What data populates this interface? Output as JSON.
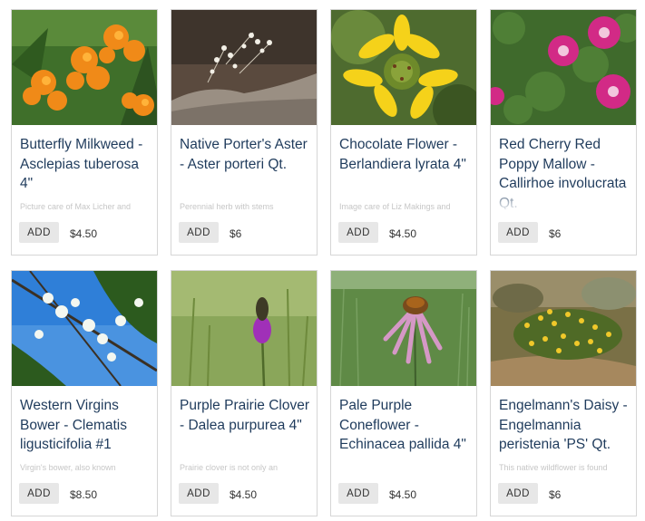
{
  "add_label": "ADD",
  "products": [
    {
      "title": "Butterfly Milkweed - Asclepias tuberosa 4\"",
      "desc": "Picture care of Max Licher and",
      "price": "$4.50",
      "image": "orange-milkweed-flowers"
    },
    {
      "title": "Native Porter's Aster - Aster porteri Qt.",
      "desc": "Perennial herb with stems",
      "price": "$6",
      "image": "white-aster-on-rock"
    },
    {
      "title": "Chocolate Flower - Berlandiera lyrata 4\"",
      "desc": "Image care of Liz Makings and",
      "price": "$4.50",
      "image": "yellow-chocolate-flower"
    },
    {
      "title": "Red Cherry Red Poppy Mallow - Callirhoe involucrata Qt.",
      "desc": "",
      "price": "$6",
      "image": "magenta-poppy-mallow"
    },
    {
      "title": "Western Virgins Bower - Clematis ligusticifolia #1",
      "desc": "Virgin's bower, also known",
      "price": "$8.50",
      "image": "white-clematis-blue-sky"
    },
    {
      "title": "Purple Prairie Clover - Dalea purpurea 4\"",
      "desc": "Prairie clover is not only an",
      "price": "$4.50",
      "image": "purple-prairie-clover"
    },
    {
      "title": "Pale Purple Coneflower - Echinacea pallida 4\"",
      "desc": "",
      "price": "$4.50",
      "image": "pale-purple-coneflower"
    },
    {
      "title": "Engelmann's Daisy - Engelmannia peristenia 'PS' Qt.",
      "desc": "This native wildflower is found",
      "price": "$6",
      "image": "yellow-daisy-shrub"
    }
  ]
}
